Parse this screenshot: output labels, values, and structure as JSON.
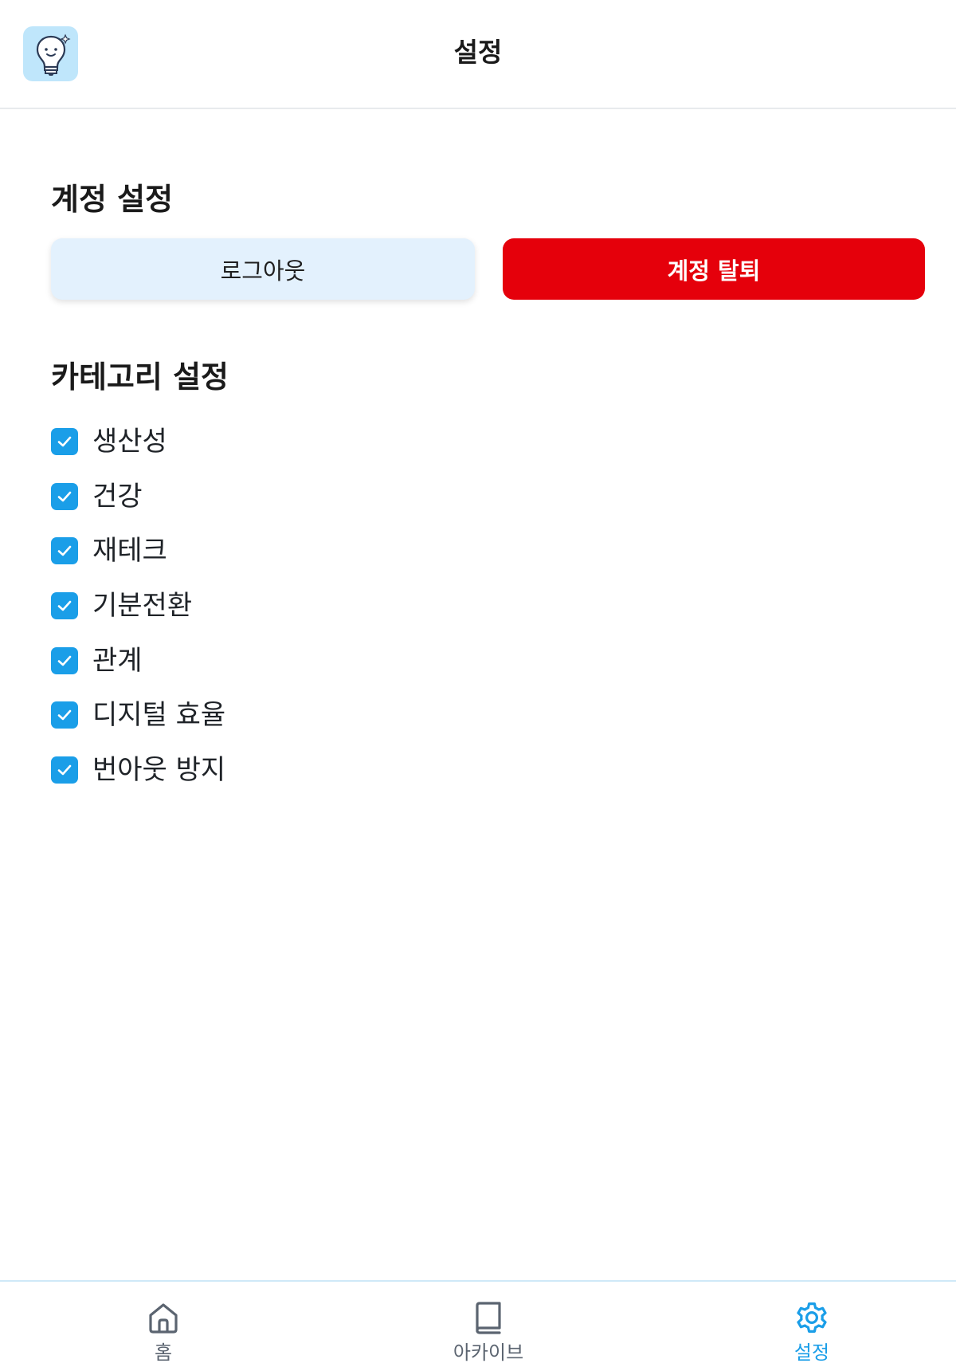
{
  "header": {
    "title": "설정",
    "logo_icon": "lightbulb-smile-icon"
  },
  "account": {
    "title": "계정 설정",
    "logout_label": "로그아웃",
    "delete_label": "계정 탈퇴"
  },
  "categories": {
    "title": "카테고리 설정",
    "items": [
      {
        "label": "생산성",
        "checked": true
      },
      {
        "label": "건강",
        "checked": true
      },
      {
        "label": "재테크",
        "checked": true
      },
      {
        "label": "기분전환",
        "checked": true
      },
      {
        "label": "관계",
        "checked": true
      },
      {
        "label": "디지털 효율",
        "checked": true
      },
      {
        "label": "번아웃 방지",
        "checked": true
      }
    ]
  },
  "nav": {
    "items": [
      {
        "label": "홈",
        "icon": "home-icon",
        "active": false
      },
      {
        "label": "아카이브",
        "icon": "book-icon",
        "active": false
      },
      {
        "label": "설정",
        "icon": "gear-icon",
        "active": true
      }
    ]
  },
  "colors": {
    "accent": "#1a9ee8",
    "danger": "#e5000b",
    "logout_bg": "#e3f1fd",
    "logo_bg": "#bfe6fb"
  }
}
